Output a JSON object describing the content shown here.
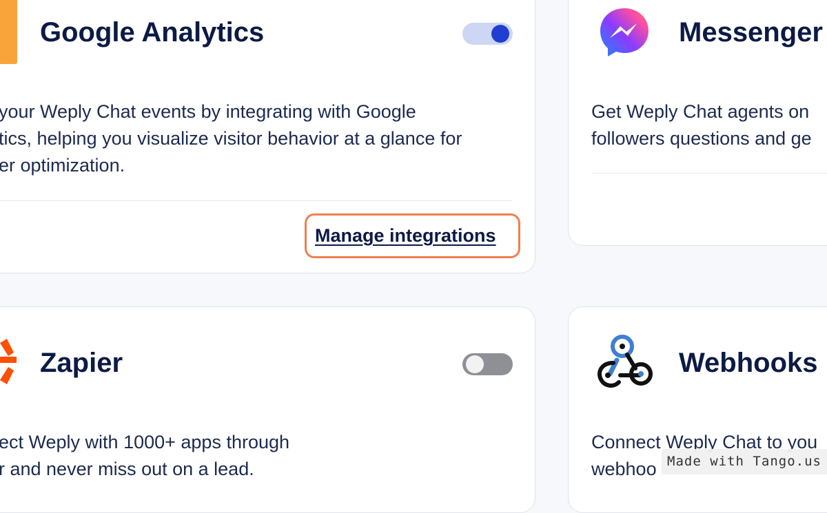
{
  "cards": {
    "google_analytics": {
      "title": "Google Analytics",
      "toggle_state": "on",
      "description_lines": [
        "your Weply Chat events by integrating with Google",
        "tics, helping you visualize visitor behavior at a glance for",
        "er optimization."
      ],
      "manage_link": "Manage integrations",
      "logo_icon": "google-analytics-logo-icon",
      "logo_color": "#f9a43a"
    },
    "messenger": {
      "title": "Messenger",
      "description_lines": [
        "Get Weply Chat agents on",
        "followers questions and ge"
      ],
      "logo_icon": "messenger-logo-icon"
    },
    "zapier": {
      "title": "Zapier",
      "toggle_state": "off",
      "description_lines": [
        "ect Weply with 1000+ apps through",
        "r and never miss out on a lead."
      ],
      "logo_icon": "zapier-logo-icon",
      "logo_color": "#ff4f00"
    },
    "webhooks": {
      "title": "Webhooks",
      "description_lines": [
        "Connect Weply Chat to you",
        "webhoo"
      ],
      "logo_icon": "webhooks-logo-icon"
    }
  },
  "watermark": "Made with Tango.us",
  "colors": {
    "accent": "#1f3fd0",
    "highlight_border": "#f07f4e",
    "title_text": "#0c1a45",
    "page_background": "#f7f8fc"
  }
}
